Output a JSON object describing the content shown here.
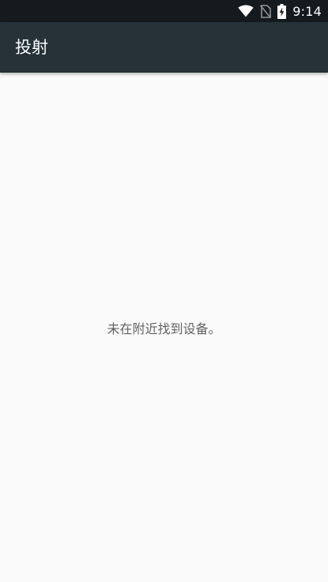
{
  "status_bar": {
    "time": "9:14",
    "icons": [
      "wifi-icon",
      "no-sim-icon",
      "battery-charging-icon"
    ]
  },
  "app_bar": {
    "title": "投射"
  },
  "main": {
    "empty_message": "未在附近找到设备。"
  },
  "colors": {
    "status_bar": "#141a1d",
    "app_bar": "#263238",
    "background": "#fafafa",
    "message_text": "#616161"
  }
}
